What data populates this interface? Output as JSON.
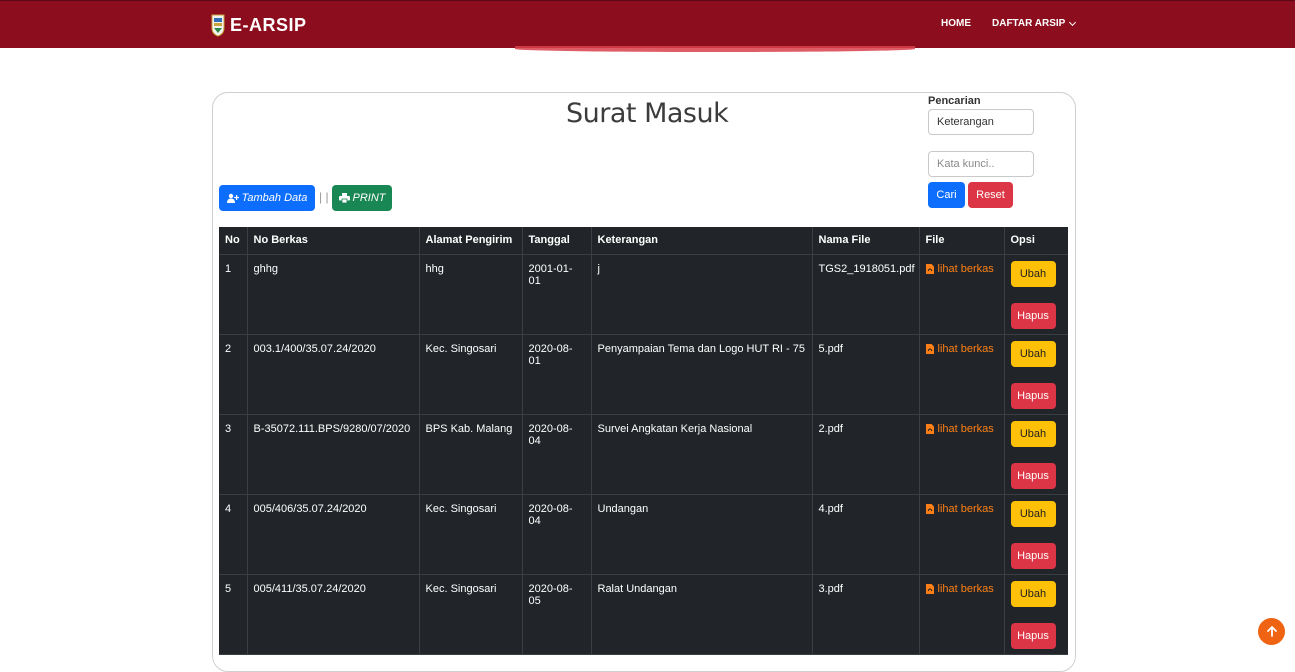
{
  "header": {
    "brand": "E-ARSIP",
    "nav": {
      "home": "HOME",
      "daftar": "DAFTAR ARSIP"
    }
  },
  "page": {
    "title": "Surat Masuk"
  },
  "search": {
    "label": "Pencarian",
    "field_value": "Keterangan",
    "keyword_placeholder": "Kata kunci..",
    "cari": "Cari",
    "reset": "Reset"
  },
  "toolbar": {
    "tambah": "Tambah Data",
    "separator": "| |",
    "print": "PRINT"
  },
  "table": {
    "headers": [
      "No",
      "No Berkas",
      "Alamat Pengirim",
      "Tanggal",
      "Keterangan",
      "Nama File",
      "File",
      "Opsi"
    ],
    "rows": [
      {
        "no": "1",
        "no_berkas": "ghhg",
        "alamat": "hhg",
        "tanggal": "2001-01-01",
        "keterangan": "j",
        "nama_file": "TGS2_1918051.pdf",
        "file": "lihat berkas",
        "ubah": "Ubah",
        "hapus": "Hapus"
      },
      {
        "no": "2",
        "no_berkas": "003.1/400/35.07.24/2020",
        "alamat": "Kec. Singosari",
        "tanggal": "2020-08-01",
        "keterangan": "Penyampaian Tema dan Logo HUT RI - 75",
        "nama_file": "5.pdf",
        "file": "lihat berkas",
        "ubah": "Ubah",
        "hapus": "Hapus"
      },
      {
        "no": "3",
        "no_berkas": "B-35072.111.BPS/9280/07/2020",
        "alamat": "BPS Kab. Malang",
        "tanggal": "2020-08-04",
        "keterangan": "Survei Angkatan Kerja Nasional",
        "nama_file": "2.pdf",
        "file": "lihat berkas",
        "ubah": "Ubah",
        "hapus": "Hapus"
      },
      {
        "no": "4",
        "no_berkas": "005/406/35.07.24/2020",
        "alamat": "Kec. Singosari",
        "tanggal": "2020-08-04",
        "keterangan": "Undangan",
        "nama_file": "4.pdf",
        "file": "lihat berkas",
        "ubah": "Ubah",
        "hapus": "Hapus"
      },
      {
        "no": "5",
        "no_berkas": "005/411/35.07.24/2020",
        "alamat": "Kec. Singosari",
        "tanggal": "2020-08-05",
        "keterangan": "Ralat Undangan",
        "nama_file": "3.pdf",
        "file": "lihat berkas",
        "ubah": "Ubah",
        "hapus": "Hapus"
      }
    ]
  },
  "colors": {
    "header": "#8c0e1e",
    "primary": "#0d6efd",
    "success": "#198754",
    "danger": "#dc3545",
    "warning": "#ffc107",
    "link": "#fd7e14",
    "table_bg": "#212529"
  },
  "icons": {
    "brand": "crest-logo-icon",
    "tambah": "user-plus-icon",
    "print": "printer-icon",
    "file": "pdf-file-icon",
    "scroll_top": "arrow-up-icon",
    "dropdown": "chevron-down-icon"
  }
}
